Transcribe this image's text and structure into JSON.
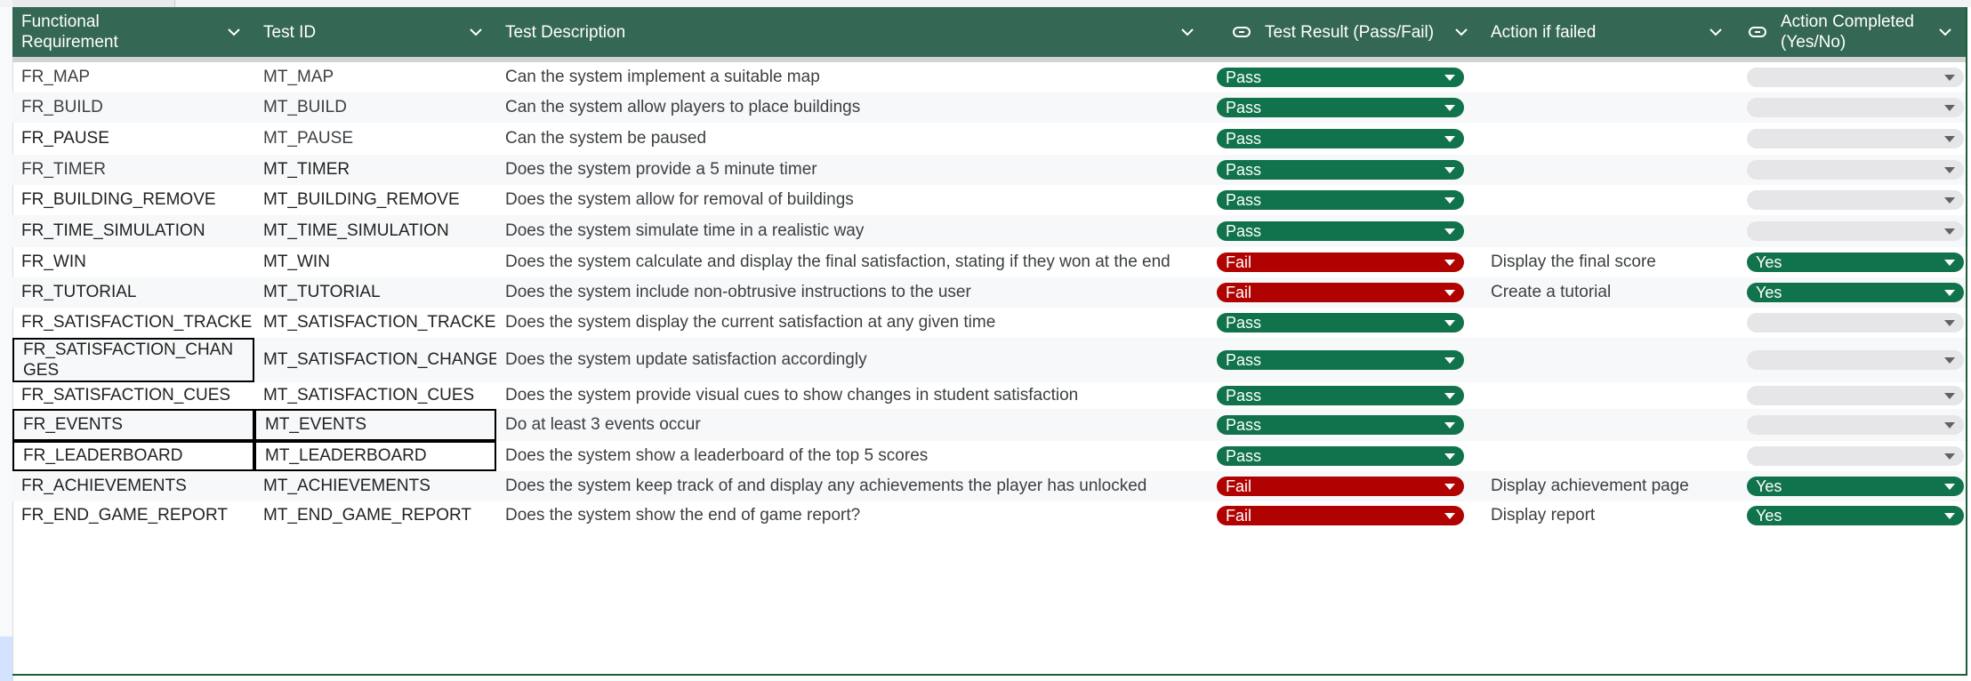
{
  "columns": [
    {
      "label": "Functional Requirement",
      "icon": "chevron-down-icon"
    },
    {
      "label": "Test ID",
      "icon": "chevron-down-icon"
    },
    {
      "label": "Test Description",
      "icon": "chevron-down-icon"
    },
    {
      "label": "Test Result (Pass/Fail)",
      "icon": "chevron-down-icon"
    },
    {
      "label": "Action if failed",
      "icon": "chevron-down-icon"
    },
    {
      "label": "Action Completed (Yes/No)",
      "icon": "chevron-down-icon"
    }
  ],
  "colors": {
    "header_bg": "#356854",
    "pass": "#11734b",
    "fail": "#b10202",
    "yes": "#11734b",
    "empty": "#e6e6e8"
  },
  "rows": [
    {
      "req": "FR_MAP",
      "id": "MT_MAP",
      "desc": "Can the system implement a suitable map",
      "result": "Pass",
      "action": "",
      "completed": ""
    },
    {
      "req": "FR_BUILD",
      "id": "MT_BUILD",
      "desc": "Can the system allow players to place buildings",
      "result": "Pass",
      "action": "",
      "completed": ""
    },
    {
      "req": "FR_PAUSE",
      "id": "MT_PAUSE",
      "desc": "Can the system be paused",
      "result": "Pass",
      "action": "",
      "completed": ""
    },
    {
      "req": "FR_TIMER",
      "id": "MT_TIMER",
      "desc": "Does the system provide a 5 minute timer",
      "result": "Pass",
      "action": "",
      "completed": ""
    },
    {
      "req": "FR_BUILDING_REMOVE",
      "id": "MT_BUILDING_REMOVE",
      "desc": "Does the system allow for removal of buildings",
      "result": "Pass",
      "action": "",
      "completed": ""
    },
    {
      "req": "FR_TIME_SIMULATION",
      "id": "MT_TIME_SIMULATION",
      "desc": "Does the system simulate time in a realistic way",
      "result": "Pass",
      "action": "",
      "completed": ""
    },
    {
      "req": "FR_WIN",
      "id": "MT_WIN",
      "desc": "Does the system calculate and display the final satisfaction, stating if they won at the end",
      "result": "Fail",
      "action": "Display the final score",
      "completed": "Yes"
    },
    {
      "req": "FR_TUTORIAL",
      "id": "MT_TUTORIAL",
      "desc": "Does the system include non-obtrusive instructions to the user",
      "result": "Fail",
      "action": "Create a tutorial",
      "completed": "Yes"
    },
    {
      "req": "FR_SATISFACTION_TRACKE",
      "id": "MT_SATISFACTION_TRACKE",
      "desc": "Does the system display the current satisfaction at any given time",
      "result": "Pass",
      "action": "",
      "completed": ""
    },
    {
      "req": "FR_SATISFACTION_CHAN GES",
      "id": "MT_SATISFACTION_CHANGE",
      "desc": "Does the system update satisfaction accordingly",
      "result": "Pass",
      "action": "",
      "completed": ""
    },
    {
      "req": "FR_SATISFACTION_CUES",
      "id": "MT_SATISFACTION_CUES",
      "desc": "Does the system provide visual cues to show changes in student satisfaction",
      "result": "Pass",
      "action": "",
      "completed": ""
    },
    {
      "req": "FR_EVENTS",
      "id": "MT_EVENTS",
      "desc": "Do at least 3 events occur",
      "result": "Pass",
      "action": "",
      "completed": ""
    },
    {
      "req": "FR_LEADERBOARD",
      "id": "MT_LEADERBOARD",
      "desc": "Does the system show a leaderboard of the top 5 scores",
      "result": "Pass",
      "action": "",
      "completed": ""
    },
    {
      "req": "FR_ACHIEVEMENTS",
      "id": "MT_ACHIEVEMENTS",
      "desc": "Does the system keep track of and display any achievements the player has unlocked",
      "result": "Fail",
      "action": "Display achievement page",
      "completed": "Yes"
    },
    {
      "req": "FR_END_GAME_REPORT",
      "id": "MT_END_GAME_REPORT",
      "desc": "Does the system show the end of game report?",
      "result": "Fail",
      "action": "Display report",
      "completed": "Yes"
    }
  ]
}
